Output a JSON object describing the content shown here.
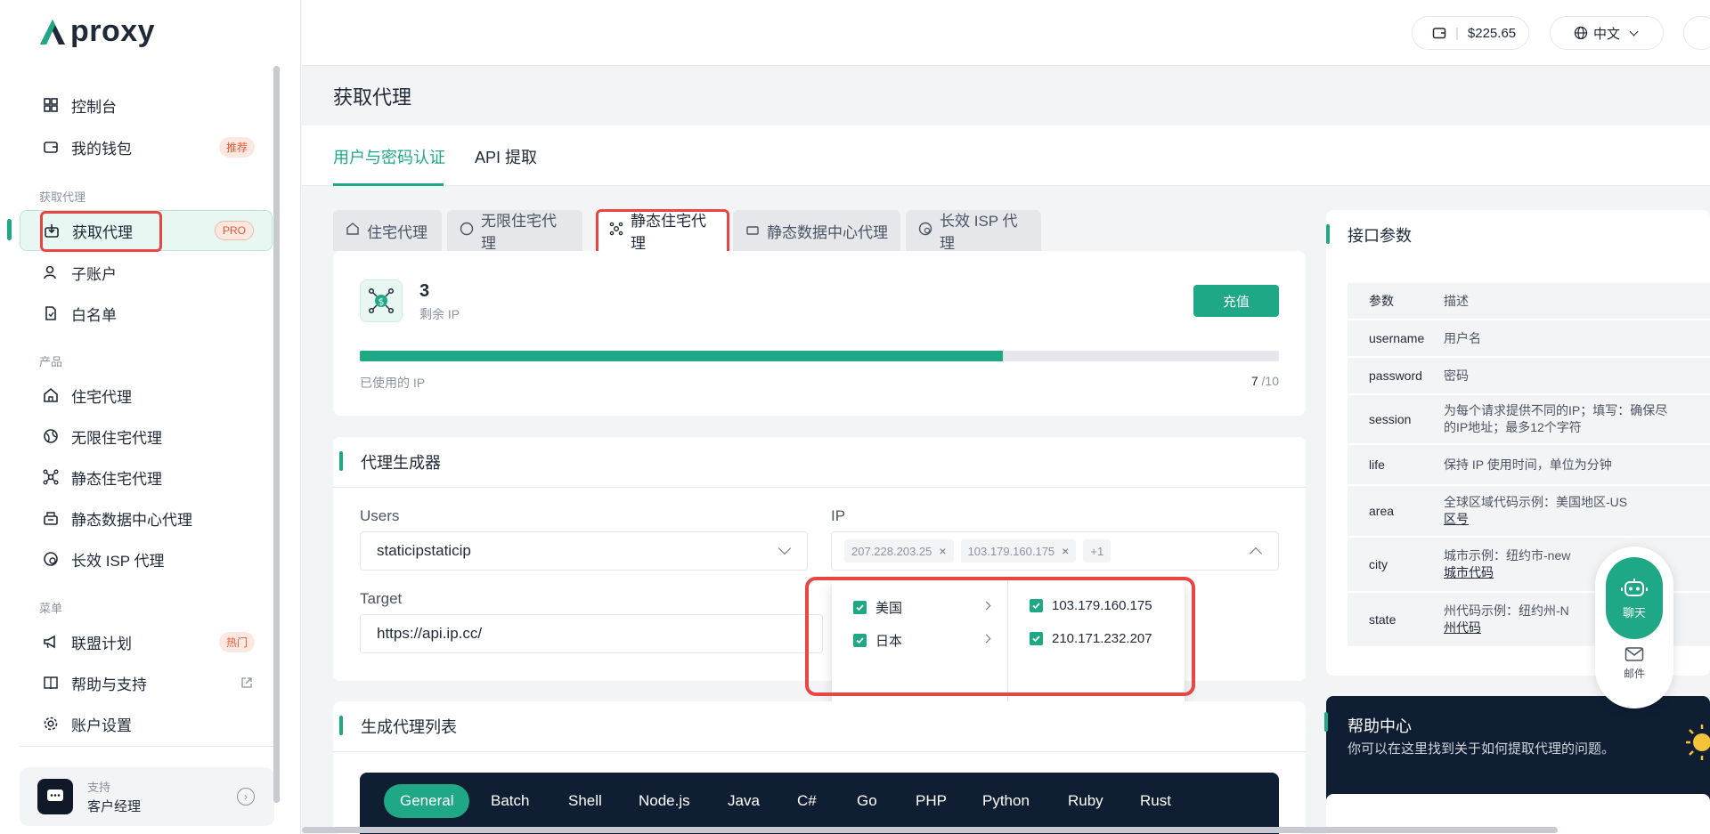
{
  "brand": {
    "name": "proxy"
  },
  "header": {
    "balance": "$225.65",
    "language": "中文"
  },
  "sidebar": {
    "items": [
      {
        "label": "控制台"
      },
      {
        "label": "我的钱包",
        "badge": "推荐"
      },
      {
        "label": "获取代理",
        "badge": "PRO"
      },
      {
        "label": "子账户"
      },
      {
        "label": "白名单"
      },
      {
        "label": "住宅代理"
      },
      {
        "label": "无限住宅代理"
      },
      {
        "label": "静态住宅代理"
      },
      {
        "label": "静态数据中心代理"
      },
      {
        "label": "长效 ISP 代理"
      },
      {
        "label": "联盟计划",
        "badge": "热门"
      },
      {
        "label": "帮助与支持"
      },
      {
        "label": "账户设置"
      }
    ],
    "groups": [
      "获取代理",
      "产品",
      "菜单"
    ],
    "support": {
      "title": "支持",
      "name": "客户经理"
    }
  },
  "page": {
    "title": "获取代理"
  },
  "main_tabs": [
    {
      "label": "用户与密码认证"
    },
    {
      "label": "API 提取"
    }
  ],
  "product_tabs": [
    {
      "label": "住宅代理"
    },
    {
      "label": "无限住宅代理"
    },
    {
      "label": "静态住宅代理"
    },
    {
      "label": "静态数据中心代理"
    },
    {
      "label": "长效 ISP 代理"
    }
  ],
  "ip_summary": {
    "remaining": "3",
    "remaining_label": "剩余 IP",
    "recharge_label": "充值",
    "used_label": "已使用的 IP",
    "used": "7",
    "total": "/10",
    "used_fraction": 0.7
  },
  "generator": {
    "title": "代理生成器",
    "users_label": "Users",
    "users_value": "staticipstaticip",
    "ip_label": "IP",
    "ip_tags": [
      "207.228.203.25",
      "103.179.160.175",
      "+1"
    ],
    "target_label": "Target",
    "target_value": "https://api.ip.cc/",
    "dropdown": {
      "countries": [
        "美国",
        "日本"
      ],
      "ips": [
        "103.179.160.175",
        "210.171.232.207"
      ]
    }
  },
  "proxy_list": {
    "title": "生成代理列表",
    "code_tabs": [
      "General",
      "Batch",
      "Shell",
      "Node.js",
      "Java",
      "C#",
      "Go",
      "PHP",
      "Python",
      "Ruby",
      "Rust"
    ]
  },
  "params": {
    "title": "接口参数",
    "headers": [
      "参数",
      "描述"
    ],
    "rows": [
      {
        "name": "username",
        "desc": "用户名"
      },
      {
        "name": "password",
        "desc": "密码"
      },
      {
        "name": "session",
        "desc": "为每个请求提供不同的IP；填写：确保尽",
        "desc2": "的IP地址；最多12个字符"
      },
      {
        "name": "life",
        "desc": "保持 IP 使用时间，单位为分钟"
      },
      {
        "name": "area",
        "desc": "全球区域代码示例：美国地区-US",
        "link": "区号"
      },
      {
        "name": "city",
        "desc": "城市示例：纽约市-new",
        "link": "城市代码"
      },
      {
        "name": "state",
        "desc": "州代码示例：纽约州-N",
        "link": "州代码"
      }
    ]
  },
  "help": {
    "title": "帮助中心",
    "desc": "你可以在这里找到关于如何提取代理的问题。"
  },
  "float": {
    "chat": "聊天",
    "mail": "邮件"
  },
  "colors": {
    "accent": "#1ea885",
    "highlight": "#e84545",
    "dark": "#0f1e33"
  }
}
